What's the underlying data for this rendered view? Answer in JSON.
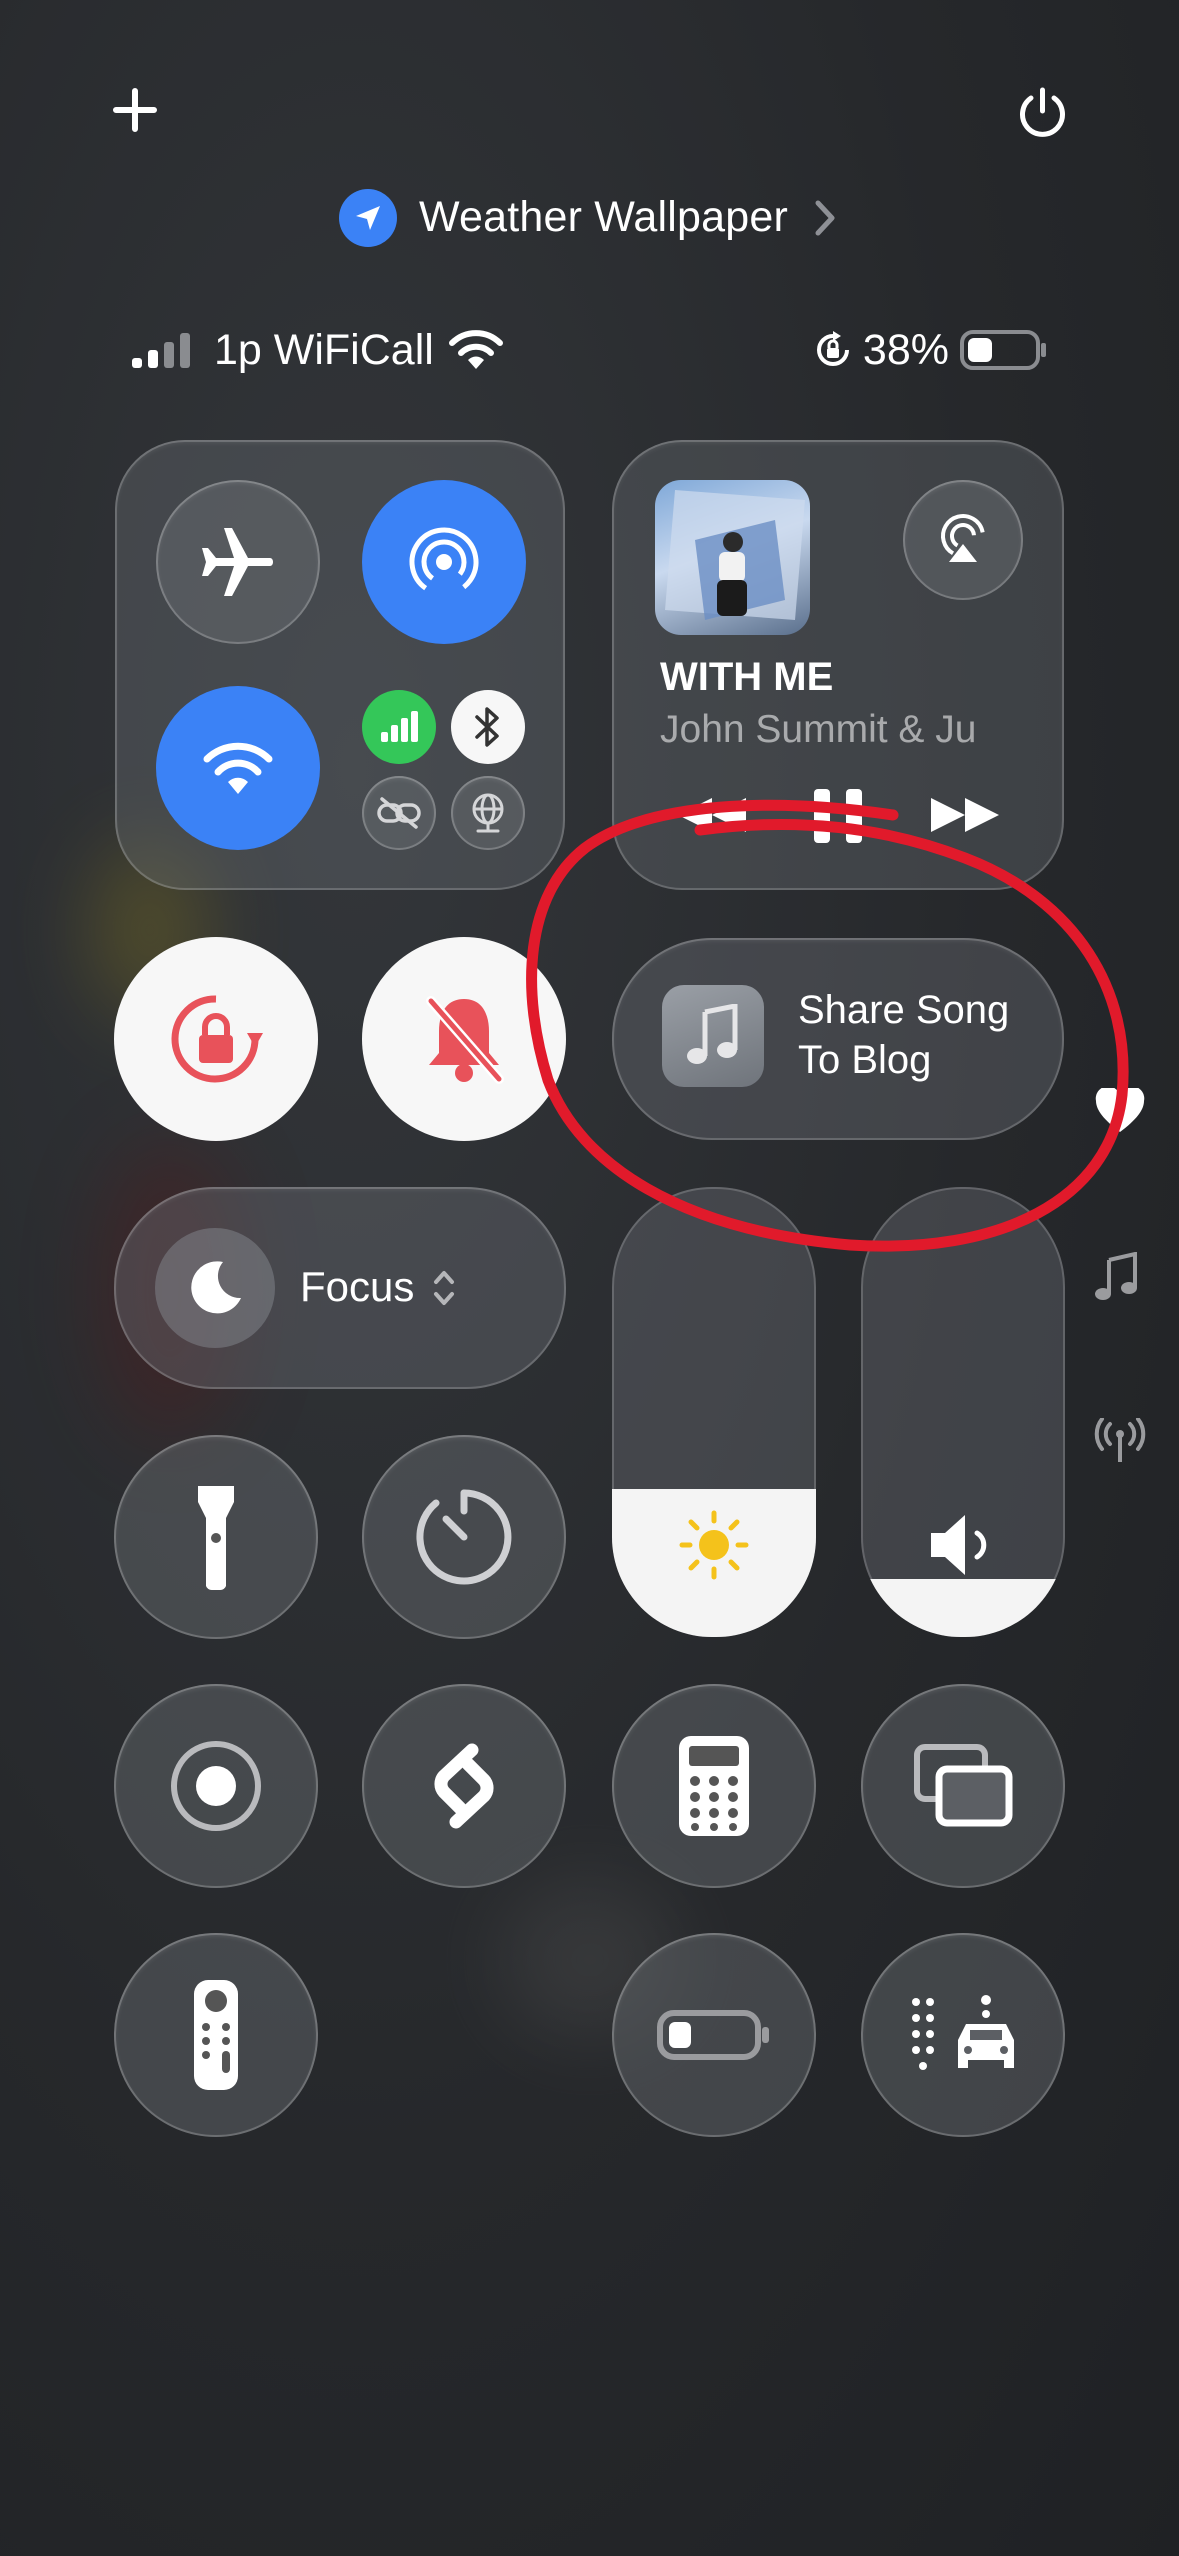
{
  "header": {
    "add_icon": "plus-icon",
    "power_icon": "power-icon",
    "location_label": "Weather Wallpaper"
  },
  "status_bar": {
    "carrier": "1p WiFiCall",
    "battery_percent": "38%",
    "battery_level": 0.38
  },
  "connectivity": {
    "airplane": {
      "icon": "airplane-icon",
      "on": false
    },
    "airdrop": {
      "icon": "airdrop-icon",
      "on": true
    },
    "wifi": {
      "icon": "wifi-icon",
      "on": true
    },
    "cellular": {
      "icon": "cellular-icon",
      "on": true
    },
    "bluetooth": {
      "icon": "bluetooth-icon",
      "on": true
    },
    "hotspot": {
      "icon": "link-icon",
      "on": false
    },
    "vpn": {
      "icon": "globe-icon",
      "on": false
    }
  },
  "media": {
    "title": "WITH ME",
    "artist": "John Summit & Ju",
    "airplay_icon": "airplay-icon"
  },
  "shortcut": {
    "line1": "Share Song",
    "line2": "To Blog",
    "icon": "music-note-icon"
  },
  "focus": {
    "label": "Focus"
  },
  "sliders": {
    "brightness": {
      "icon": "sun-icon",
      "level": 0.33
    },
    "volume": {
      "icon": "speaker-icon",
      "level": 0.13
    }
  },
  "side_indicators": [
    "heart-icon",
    "music-note-icon",
    "antenna-icon"
  ],
  "controls": [
    "rotation-lock-icon",
    "silent-mode-icon",
    "flashlight-icon",
    "timer-icon",
    "screen-record-icon",
    "shazam-icon",
    "calculator-icon",
    "screen-mirroring-icon",
    "remote-icon",
    "low-power-icon",
    "driving-focus-icon"
  ],
  "colors": {
    "accent_blue": "#3b82f6",
    "cell_green": "#34c759",
    "alert_red": "#e8525a",
    "annotation_red": "#e11a2b"
  }
}
